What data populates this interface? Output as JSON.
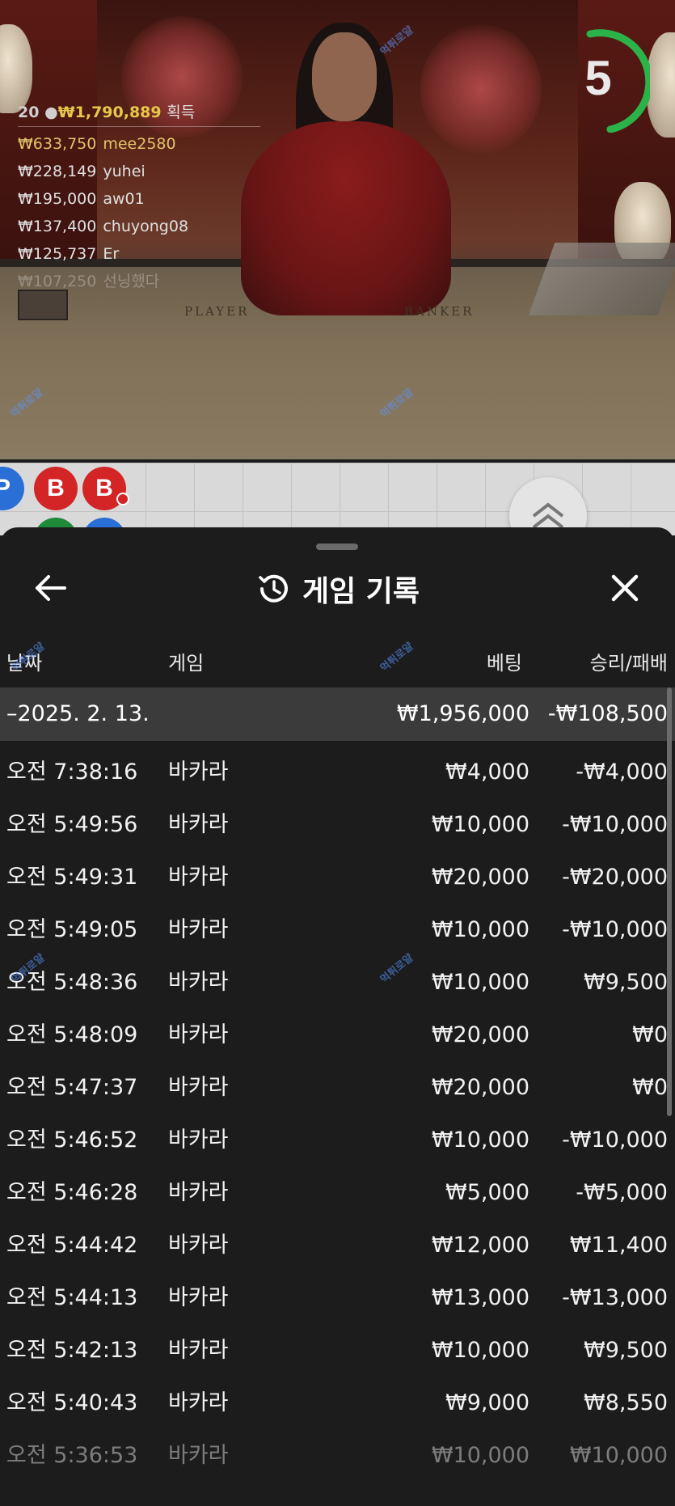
{
  "video": {
    "winners_header": {
      "count": "20",
      "amount": "₩1,790,889",
      "label": "획득"
    },
    "winners": [
      {
        "amount": "₩633,750",
        "name": "mee2580"
      },
      {
        "amount": "₩228,149",
        "name": "yuhei"
      },
      {
        "amount": "₩195,000",
        "name": "aw01"
      },
      {
        "amount": "₩137,400",
        "name": "chuyong08"
      },
      {
        "amount": "₩125,737",
        "name": "Er"
      },
      {
        "amount": "₩107,250",
        "name": "선닝했다"
      }
    ],
    "table_labels": {
      "player": "PLAYER",
      "banker": "BANKER"
    },
    "timer": {
      "value": "5",
      "color": "#2bb34a"
    },
    "watermark_text": "먹튀로얄"
  },
  "road": {
    "beads": [
      "P",
      "B",
      "B"
    ]
  },
  "sheet": {
    "title": "게임 기록",
    "icons": {
      "back": "arrow-left-icon",
      "title": "history-icon",
      "close": "close-icon"
    },
    "columns": {
      "date": "날짜",
      "game": "게임",
      "bet": "베팅",
      "result": "승리/패배"
    },
    "date_group": {
      "date": "–2025. 2. 13.",
      "bet_total": "₩1,956,000",
      "result_total": "-₩108,500"
    },
    "rows": [
      {
        "time": "오전 7:38:16",
        "game": "바카라",
        "bet": "₩4,000",
        "result": "-₩4,000"
      },
      {
        "time": "오전 5:49:56",
        "game": "바카라",
        "bet": "₩10,000",
        "result": "-₩10,000"
      },
      {
        "time": "오전 5:49:31",
        "game": "바카라",
        "bet": "₩20,000",
        "result": "-₩20,000"
      },
      {
        "time": "오전 5:49:05",
        "game": "바카라",
        "bet": "₩10,000",
        "result": "-₩10,000"
      },
      {
        "time": "오전 5:48:36",
        "game": "바카라",
        "bet": "₩10,000",
        "result": "₩9,500"
      },
      {
        "time": "오전 5:48:09",
        "game": "바카라",
        "bet": "₩20,000",
        "result": "₩0"
      },
      {
        "time": "오전 5:47:37",
        "game": "바카라",
        "bet": "₩20,000",
        "result": "₩0"
      },
      {
        "time": "오전 5:46:52",
        "game": "바카라",
        "bet": "₩10,000",
        "result": "-₩10,000"
      },
      {
        "time": "오전 5:46:28",
        "game": "바카라",
        "bet": "₩5,000",
        "result": "-₩5,000"
      },
      {
        "time": "오전 5:44:42",
        "game": "바카라",
        "bet": "₩12,000",
        "result": "₩11,400"
      },
      {
        "time": "오전 5:44:13",
        "game": "바카라",
        "bet": "₩13,000",
        "result": "-₩13,000"
      },
      {
        "time": "오전 5:42:13",
        "game": "바카라",
        "bet": "₩10,000",
        "result": "₩9,500"
      },
      {
        "time": "오전 5:40:43",
        "game": "바카라",
        "bet": "₩9,000",
        "result": "₩8,550"
      },
      {
        "time": "오전 5:36:53",
        "game": "바카라",
        "bet": "₩10,000",
        "result": "₩10,000"
      }
    ]
  }
}
